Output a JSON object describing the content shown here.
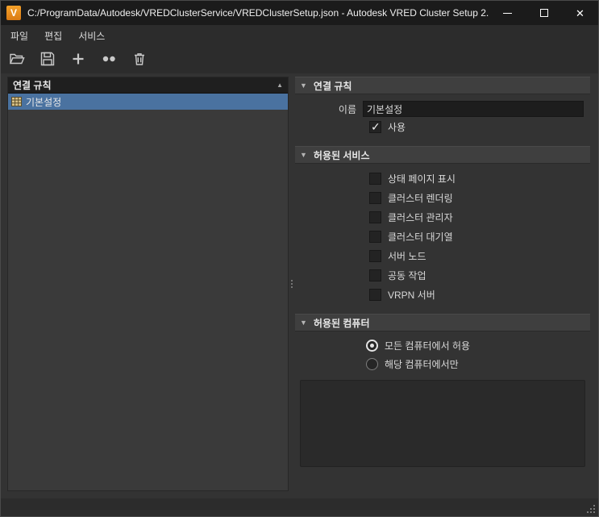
{
  "window": {
    "title": "C:/ProgramData/Autodesk/VREDClusterService/VREDClusterSetup.json - Autodesk VRED Cluster Setup 2...",
    "app_initial": "V"
  },
  "menubar": {
    "items": [
      {
        "label": "파일"
      },
      {
        "label": "편집"
      },
      {
        "label": "서비스"
      }
    ]
  },
  "left_panel": {
    "header": "연결 규칙",
    "items": [
      {
        "label": "기본설정",
        "selected": true
      }
    ]
  },
  "right_panel": {
    "connection": {
      "title": "연결 규칙",
      "name_label": "이름",
      "name_value": "기본설정",
      "enabled_label": "사용",
      "enabled_checked": true
    },
    "services": {
      "title": "허용된 서비스",
      "options": [
        {
          "label": "상태 페이지 표시",
          "checked": false
        },
        {
          "label": "클러스터 렌더링",
          "checked": false
        },
        {
          "label": "클러스터 관리자",
          "checked": false
        },
        {
          "label": "클러스터 대기열",
          "checked": false
        },
        {
          "label": "서버 노드",
          "checked": false
        },
        {
          "label": "공동 작업",
          "checked": false
        },
        {
          "label": "VRPN 서버",
          "checked": false
        }
      ]
    },
    "computers": {
      "title": "허용된 컴퓨터",
      "options": [
        {
          "label": "모든 컴퓨터에서 허용",
          "selected": true
        },
        {
          "label": "해당 컴퓨터에서만",
          "selected": false
        }
      ],
      "list_value": ""
    }
  },
  "colors": {
    "selection_blue": "#4a72a0",
    "accent_orange": "#e98f1f",
    "titlebar": "#1b1b1b"
  }
}
